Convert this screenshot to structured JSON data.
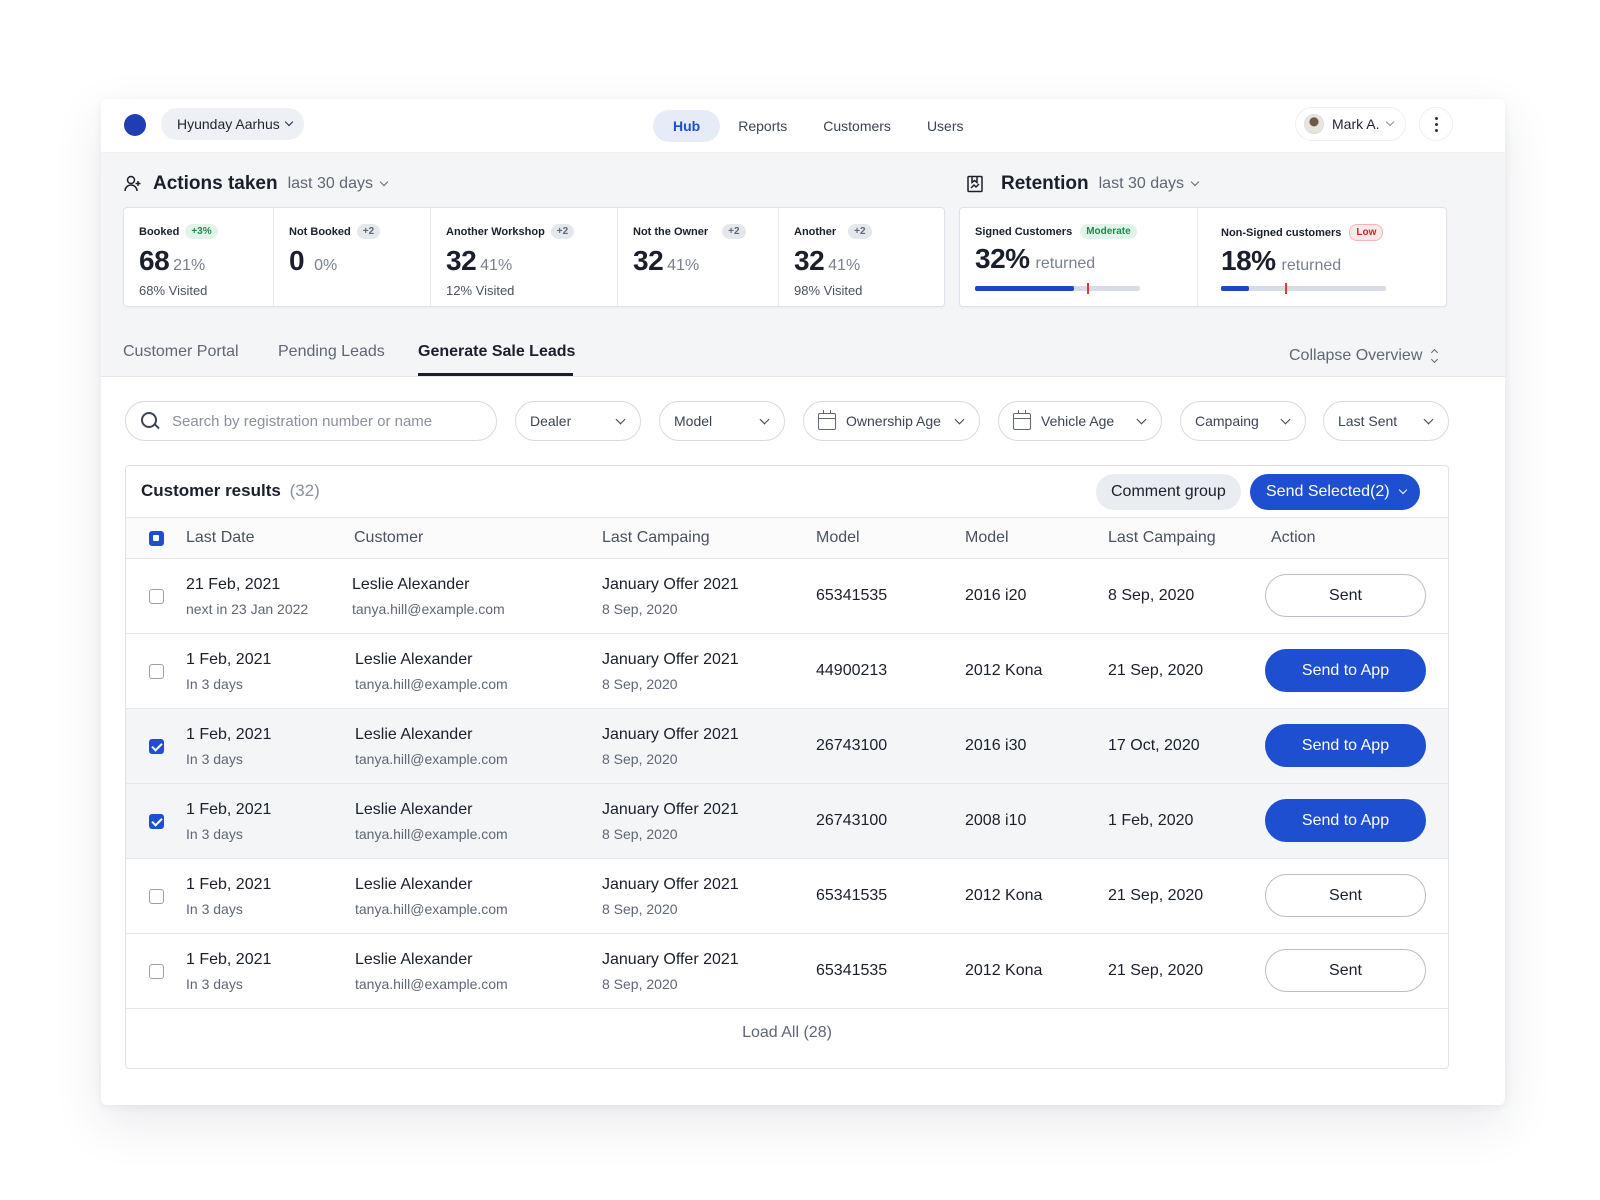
{
  "header": {
    "dealer": "Hyunday Aarhus",
    "nav": [
      {
        "label": "Hub",
        "active": true
      },
      {
        "label": "Reports",
        "active": false
      },
      {
        "label": "Customers",
        "active": false
      },
      {
        "label": "Users",
        "active": false
      }
    ],
    "user": "Mark A."
  },
  "actions": {
    "title": "Actions taken",
    "period": "last 30 days",
    "stats": [
      {
        "label": "Booked",
        "badge": "+3%",
        "value": "68",
        "pct": "21%",
        "visited": "68% Visited"
      },
      {
        "label": "Not Booked",
        "badge": "+2",
        "value": "0",
        "pct": "0%",
        "visited": ""
      },
      {
        "label": "Another Workshop",
        "badge": "+2",
        "value": "32",
        "pct": "41%",
        "visited": "12% Visited"
      },
      {
        "label": "Not the Owner",
        "badge": "+2",
        "value": "32",
        "pct": "41%",
        "visited": ""
      },
      {
        "label": "Another",
        "badge": "+2",
        "value": "32",
        "pct": "41%",
        "visited": "98% Visited"
      }
    ]
  },
  "retention": {
    "title": "Retention",
    "period": "last 30 days",
    "stats": [
      {
        "label": "Signed Customers",
        "badge": "Moderate",
        "value": "32%",
        "suffix": "returned",
        "fill": 0.6,
        "marker": 0.68
      },
      {
        "label": "Non-Signed customers",
        "badge": "Low",
        "value": "18%",
        "suffix": "returned",
        "fill": 0.17,
        "marker": 0.39
      }
    ]
  },
  "tabs": {
    "items": [
      "Customer  Portal",
      "Pending Leads",
      "Generate Sale Leads"
    ],
    "active_index": 2,
    "collapse": "Collapse Overview"
  },
  "filters": {
    "search_placeholder": "Search by registration number or name",
    "dealer": "Dealer",
    "model": "Model",
    "ownership_age": "Ownership Age",
    "vehicle_age": "Vehicle Age",
    "campaign": "Campaing",
    "last_sent": "Last Sent"
  },
  "results": {
    "title": "Customer results",
    "count": "(32)",
    "comment_group": "Comment group",
    "send_selected": "Send Selected(2)",
    "columns": [
      "Last Date",
      "Customer",
      "Last Campaing",
      "Model",
      "Model",
      "Last Campaing",
      "Action"
    ],
    "rows": [
      {
        "checked": false,
        "date": "21 Feb, 2021",
        "date_sub": "next in 23 Jan 2022",
        "name": "Leslie Alexander",
        "email": "tanya.hill@example.com",
        "campaign": "January Offer 2021",
        "campaign_date": "8 Sep, 2020",
        "reg": "65341535",
        "model": "2016 i20",
        "last_campaign": "8 Sep, 2020",
        "action": "Sent",
        "action_style": "outline"
      },
      {
        "checked": false,
        "date": "1 Feb, 2021",
        "date_sub": "In 3 days",
        "name": "Leslie Alexander",
        "email": "tanya.hill@example.com",
        "campaign": "January Offer 2021",
        "campaign_date": "8 Sep, 2020",
        "reg": "44900213",
        "model": "2012 Kona",
        "last_campaign": "21 Sep, 2020",
        "action": "Send to App",
        "action_style": "primary"
      },
      {
        "checked": true,
        "date": "1 Feb, 2021",
        "date_sub": "In 3 days",
        "name": "Leslie Alexander",
        "email": "tanya.hill@example.com",
        "campaign": "January Offer 2021",
        "campaign_date": "8 Sep, 2020",
        "reg": "26743100",
        "model": "2016 i30",
        "last_campaign": "17 Oct, 2020",
        "action": "Send to App",
        "action_style": "primary"
      },
      {
        "checked": true,
        "date": "1 Feb, 2021",
        "date_sub": "In 3 days",
        "name": "Leslie Alexander",
        "email": "tanya.hill@example.com",
        "campaign": "January Offer 2021",
        "campaign_date": "8 Sep, 2020",
        "reg": "26743100",
        "model": "2008 i10",
        "last_campaign": "1 Feb, 2020",
        "action": "Send to App",
        "action_style": "primary"
      },
      {
        "checked": false,
        "date": "1 Feb, 2021",
        "date_sub": "In 3 days",
        "name": "Leslie Alexander",
        "email": "tanya.hill@example.com",
        "campaign": "January Offer 2021",
        "campaign_date": "8 Sep, 2020",
        "reg": "65341535",
        "model": "2012 Kona",
        "last_campaign": "21 Sep, 2020",
        "action": "Sent",
        "action_style": "outline"
      },
      {
        "checked": false,
        "date": "1 Feb, 2021",
        "date_sub": "In 3 days",
        "name": "Leslie Alexander",
        "email": "tanya.hill@example.com",
        "campaign": "January Offer 2021",
        "campaign_date": "8 Sep, 2020",
        "reg": "65341535",
        "model": "2012 Kona",
        "last_campaign": "21 Sep, 2020",
        "action": "Sent",
        "action_style": "outline"
      }
    ],
    "load_all": "Load All (28)"
  },
  "colors": {
    "accent": "#1f4fd1",
    "brand_dot": "#1f3eb3",
    "marker": "#e53935"
  }
}
